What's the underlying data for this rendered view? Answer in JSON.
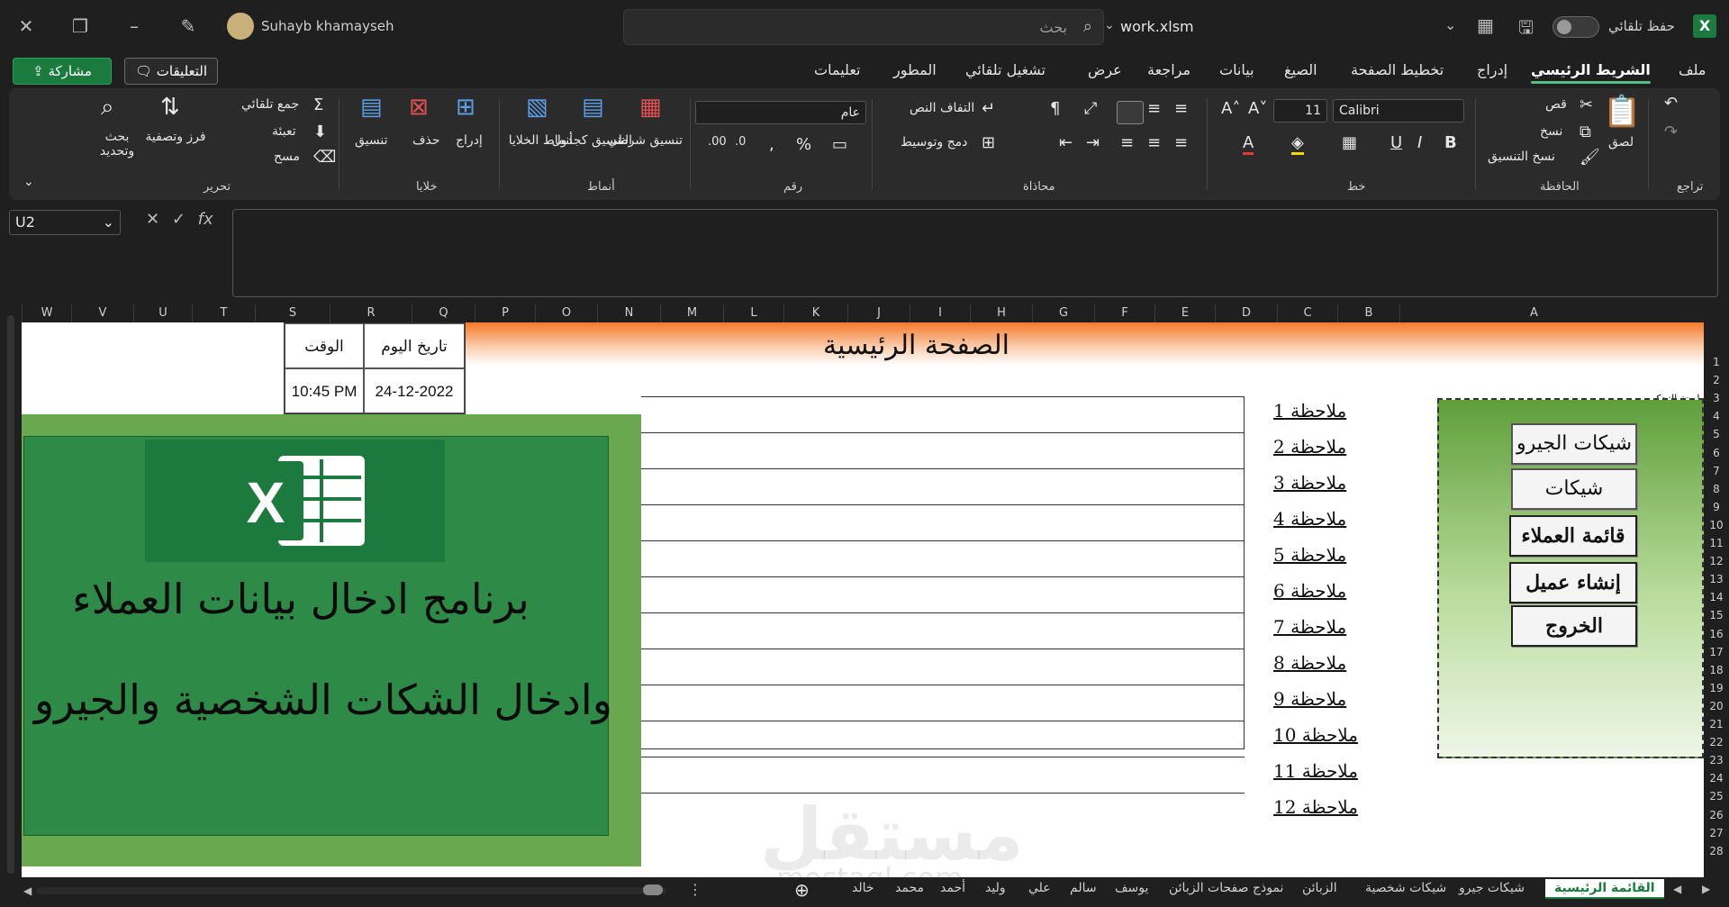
{
  "titlebar": {
    "autosave_label": "حفظ تلقائي",
    "file_name": "work.xlsm",
    "search_placeholder": "بحث",
    "user_name": "Suhayb khamayseh"
  },
  "menu_tabs": [
    "ملف",
    "الشريط الرئيسي",
    "إدراج",
    "تخطيط الصفحة",
    "الصيغ",
    "بيانات",
    "مراجعة",
    "عرض",
    "تشغيل تلقائي",
    "المطور",
    "تعليمات"
  ],
  "share_label": "مشاركة",
  "comments_label": "التعليقات",
  "ribbon": {
    "undo_label": "تراجع",
    "clipboard": {
      "paste": "لصق",
      "cut": "قص",
      "copy": "نسخ",
      "format_painter": "نسخ التنسيق",
      "group": "الحافظة"
    },
    "font": {
      "name": "Calibri",
      "size": "11",
      "group": "خط"
    },
    "alignment": {
      "wrap": "التفاف النص",
      "merge": "دمج وتوسيط",
      "group": "محاذاة"
    },
    "number": {
      "format": "عام",
      "group": "رقم"
    },
    "styles": {
      "conditional": "تنسيق شرطي",
      "as_table": "التنسيق كجدول",
      "cell_styles": "أنماط الخلايا",
      "group": "أنماط"
    },
    "cells": {
      "insert": "إدراج",
      "delete": "حذف",
      "format": "تنسيق",
      "group": "خلايا"
    },
    "editing": {
      "autosum": "جمع تلقائي",
      "fill": "تعبئة",
      "clear": "مسح",
      "sort": "فرز وتصفية",
      "find": "بحث وتحديد",
      "group": "تحرير"
    }
  },
  "formula_bar": {
    "name_box": "U2",
    "fx": "fx"
  },
  "columns": [
    "W",
    "V",
    "U",
    "T",
    "S",
    "R",
    "Q",
    "P",
    "O",
    "N",
    "M",
    "L",
    "K",
    "J",
    "I",
    "H",
    "G",
    "F",
    "E",
    "D",
    "C",
    "B",
    "A"
  ],
  "rows": [
    "1",
    "2",
    "3",
    "4",
    "5",
    "6",
    "7",
    "8",
    "9",
    "10",
    "11",
    "12",
    "13",
    "14",
    "15",
    "16",
    "17",
    "18",
    "19",
    "20",
    "21",
    "22",
    "23",
    "24",
    "25",
    "26",
    "27",
    "28"
  ],
  "sheet": {
    "page_title": "الصفحة الرئيسية",
    "date_header": "تاريخ اليوم",
    "time_header": "الوقت",
    "date_value": "24-12-2022",
    "time_value": "10:45 PM",
    "program_line1": "برنامج ادخال بيانات العملاء",
    "program_line2": "وادخال الشكات الشخصية والجيرو",
    "notes": [
      "ملاحظة 1",
      "ملاحظة 2",
      "ملاحظة 3",
      "ملاحظة 4",
      "ملاحظة 5",
      "ملاحظة 6",
      "ملاحظة 7",
      "ملاحظة 8",
      "ملاحظة 9",
      "ملاحظة 10",
      "ملاحظة 11",
      "ملاحظة 12"
    ],
    "panel_label": "لوحة التحكم",
    "panel_buttons": [
      "شيكات الجيرو",
      "شيكات شخصية",
      "قائمة العملاء",
      "إنشاء عميل جديد",
      "الخروج"
    ],
    "watermark": "مستقل",
    "watermark_sub": "mostaql.com"
  },
  "sheet_tabs": [
    "القائمة الرئيسية",
    "شيكات جيرو",
    "شيكات شخصية",
    "الزبائن",
    "نموذج صفحات الزبائن",
    "يوسف",
    "سالم",
    "علي",
    "وليد",
    "أحمد",
    "محمد",
    "خالد"
  ]
}
